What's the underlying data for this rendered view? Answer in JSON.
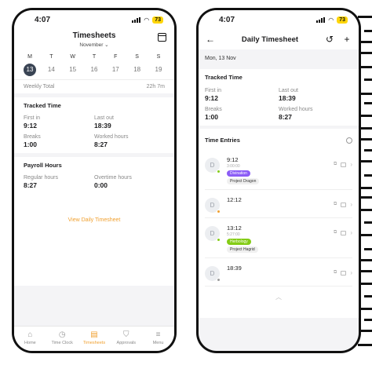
{
  "colors": {
    "accent": "#f0a030",
    "selected_day": "#3a4454",
    "battery": "#ffd60a",
    "tag_purple": "#8b5cf6",
    "tag_green": "#84cc16"
  },
  "status": {
    "time": "4:07",
    "battery": "73"
  },
  "timesheets": {
    "title": "Timesheets",
    "month": "November",
    "days": [
      {
        "letter": "M",
        "num": "13",
        "selected": true
      },
      {
        "letter": "T",
        "num": "14"
      },
      {
        "letter": "W",
        "num": "15"
      },
      {
        "letter": "T",
        "num": "16"
      },
      {
        "letter": "F",
        "num": "17"
      },
      {
        "letter": "S",
        "num": "18"
      },
      {
        "letter": "S",
        "num": "19"
      }
    ],
    "weekly_label": "Weekly Total",
    "weekly_value": "22h 7m",
    "tracked": {
      "title": "Tracked Time",
      "first_in_label": "First in",
      "first_in": "9:12",
      "last_out_label": "Last out",
      "last_out": "18:39",
      "breaks_label": "Breaks",
      "breaks": "1:00",
      "worked_label": "Worked hours",
      "worked": "8:27"
    },
    "payroll": {
      "title": "Payroll Hours",
      "regular_label": "Regular hours",
      "regular": "8:27",
      "overtime_label": "Overtime hours",
      "overtime": "0:00"
    },
    "view_link": "View Daily Timesheet",
    "tabs": [
      {
        "label": "Home",
        "icon": "home-icon"
      },
      {
        "label": "Time Clock",
        "icon": "stopwatch-icon"
      },
      {
        "label": "Timesheets",
        "icon": "timesheet-icon",
        "active": true
      },
      {
        "label": "Approvals",
        "icon": "shield-check-icon"
      },
      {
        "label": "Menu",
        "icon": "menu-icon"
      }
    ]
  },
  "daily": {
    "title": "Daily Timesheet",
    "date": "Mon, 13 Nov",
    "tracked": {
      "title": "Tracked Time",
      "first_in_label": "First in",
      "first_in": "9:12",
      "last_out_label": "Last out",
      "last_out": "18:39",
      "breaks_label": "Breaks",
      "breaks": "1:00",
      "worked_label": "Worked hours",
      "worked": "8:27"
    },
    "entries_title": "Time Entries",
    "entries": [
      {
        "avatar": "D",
        "time": "9:12",
        "end": "3:00:00",
        "dot": "#84cc16",
        "tags": [
          {
            "text": "Divination",
            "style": "purple"
          },
          {
            "text": "Project Dragon",
            "style": "grey"
          }
        ]
      },
      {
        "avatar": "D",
        "time": "12:12",
        "end": "",
        "dot": "#f0a030",
        "tags": []
      },
      {
        "avatar": "D",
        "time": "13:12",
        "end": "5:27:00",
        "dot": "#84cc16",
        "tags": [
          {
            "text": "Herbology",
            "style": "green"
          },
          {
            "text": "Project Hagrid",
            "style": "grey"
          }
        ]
      },
      {
        "avatar": "D",
        "time": "18:39",
        "end": "",
        "dot": "#9a9a9a",
        "tags": []
      }
    ]
  }
}
